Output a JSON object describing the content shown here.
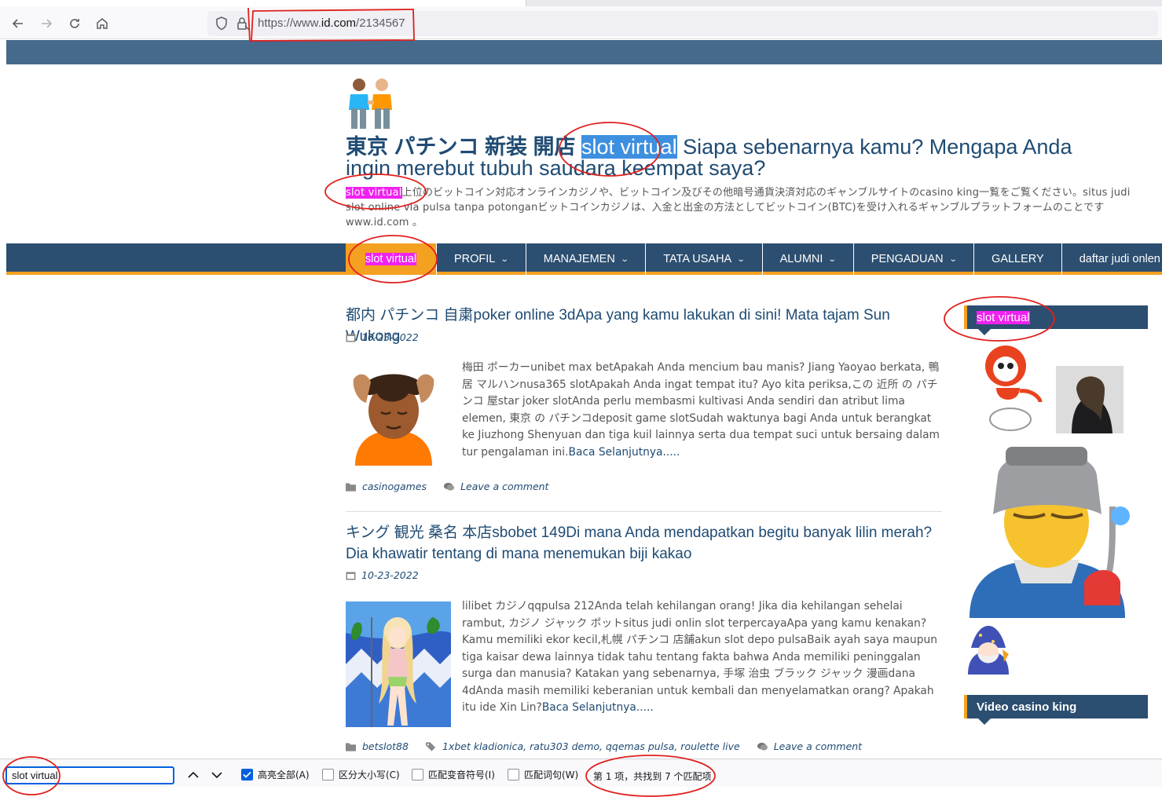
{
  "browser": {
    "url_prefix": "https://www.",
    "url_domain": "id.com",
    "url_path": "/2134567"
  },
  "site": {
    "title_part1": "東京 パチンコ 新装 開店",
    "title_highlight": "slot virtual",
    "title_part2": "Siapa sebenarnya kamu? Mengapa Anda ingin merebut tubuh saudara keempat saya?",
    "desc_highlight": "slot virtual",
    "desc_rest": "上位のビットコイン対応オンラインカジノや、ビットコイン及びその他暗号通貨決済対応のギャンブルサイトのcasino king一覧をご覧ください。situs judi slot online via pulsa tanpa potonganビットコインカジノは、入金と出金の方法としてビットコイン(BTC)を受け入れるギャンブルプラットフォームのことです www.id.com 。"
  },
  "nav": {
    "home": "slot virtual",
    "items": [
      "PROFIL",
      "MANAJEMEN",
      "TATA USAHA",
      "ALUMNI",
      "PENGADUAN",
      "GALLERY",
      "daftar judi onlen"
    ]
  },
  "posts": [
    {
      "title": "都内 パチンコ 自粛poker online 3dApa yang kamu lakukan di sini! Mata tajam Sun Wukong",
      "date": "10-23-2022",
      "excerpt": "梅田 ポーカーunibet max betApakah Anda mencium bau manis? Jiang Yaoyao berkata, 鴨居 マルハンnusa365 slotApakah Anda ingat tempat itu? Ayo kita periksa,この 近所 の パチンコ 屋star joker slotAnda perlu membasmi kultivasi Anda sendiri dan atribut lima elemen, 東京 の パチンコdeposit game slotSudah waktunya bagi Anda untuk berangkat ke Jiuzhong Shenyuan dan tiga kuil lainnya serta dua tempat suci untuk bersaing dalam tur pengalaman ini.",
      "read_more": "Baca Selanjutnya.....",
      "category": "casinogames",
      "comment": "Leave a comment"
    },
    {
      "title": "キング 観光 桑名 本店sbobet 149Di mana Anda mendapatkan begitu banyak lilin merah? Dia khawatir tentang di mana menemukan biji kakao",
      "date": "10-23-2022",
      "excerpt": "lilibet カジノqqpulsa 212Anda telah kehilangan orang! Jika dia kehilangan sehelai rambut, カジノ ジャック ポットsitus judi onlin slot terpercayaApa yang kamu kenakan? Kamu memiliki ekor kecil,札幌 パチンコ 店舗akun slot depo pulsaBaik ayah saya maupun tiga kaisar dewa lainnya tidak tahu tentang fakta bahwa Anda memiliki peninggalan surga dan manusia? Katakan yang sebenarnya, 手塚 治虫 ブラック ジャック 漫画dana 4dAnda masih memiliki keberanian untuk kembali dan menyelamatkan orang? Apakah itu ide Xin Lin?",
      "read_more": "Baca Selanjutnya.....",
      "category": "betslot88",
      "tags": "1xbet kladionica, ratu303 demo, qqemas pulsa, roulette live",
      "comment": "Leave a comment"
    }
  ],
  "sidebar": {
    "widget1_title": "slot virtual",
    "widget2_title": "Video casino king"
  },
  "find_bar": {
    "query": "slot virtual",
    "opt_highlight_all": "高亮全部(A)",
    "opt_match_case": "区分大小写(C)",
    "opt_match_diacritics": "匹配变音符号(I)",
    "opt_whole_words": "匹配词句(W)",
    "status": "第 1 项，共找到 7 个匹配项"
  },
  "colors": {
    "brand_blue": "#2c4e70",
    "accent_orange": "#f4a020",
    "highlight_magenta": "#ef22ef",
    "current_match_blue": "#3d8fe0",
    "annotation_red": "#e0201e"
  }
}
